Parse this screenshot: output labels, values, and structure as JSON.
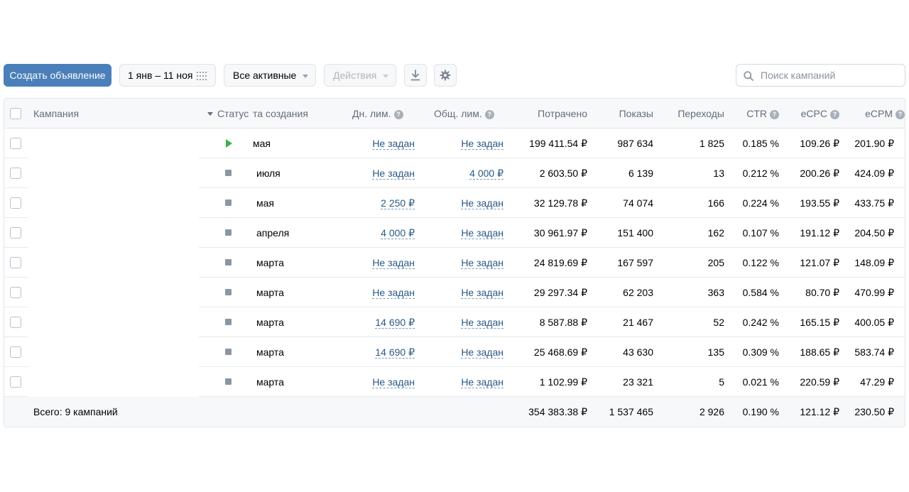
{
  "toolbar": {
    "create_label": "Создать объявление",
    "date_range": "1 янв – 11 ноя",
    "filter_label": "Все активные",
    "actions_label": "Действия",
    "download_icon": "download-icon",
    "settings_icon": "gear-icon"
  },
  "search": {
    "placeholder": "Поиск кампаний",
    "value": ""
  },
  "table": {
    "headers": {
      "campaign": "Кампания",
      "status": "Статус",
      "created": "та создания",
      "day_limit": "Дн. лим.",
      "total_limit": "Общ. лим.",
      "spent": "Потрачено",
      "impressions": "Показы",
      "clicks": "Переходы",
      "ctr": "CTR",
      "ecpc": "eCPC",
      "ecpm": "eCPM"
    },
    "help_mark": "?",
    "rows": [
      {
        "status": "running",
        "created": "мая",
        "day_limit": "Не задан",
        "total_limit": "Не задан",
        "spent": "199 411.54 ₽",
        "impressions": "987 634",
        "clicks": "1 825",
        "ctr": "0.185 %",
        "ecpc": "109.26 ₽",
        "ecpm": "201.90 ₽"
      },
      {
        "status": "stopped",
        "created": "июля",
        "day_limit": "Не задан",
        "total_limit": "4 000 ₽",
        "spent": "2 603.50 ₽",
        "impressions": "6 139",
        "clicks": "13",
        "ctr": "0.212 %",
        "ecpc": "200.26 ₽",
        "ecpm": "424.09 ₽"
      },
      {
        "status": "stopped",
        "created": "мая",
        "day_limit": "2 250 ₽",
        "total_limit": "Не задан",
        "spent": "32 129.78 ₽",
        "impressions": "74 074",
        "clicks": "166",
        "ctr": "0.224 %",
        "ecpc": "193.55 ₽",
        "ecpm": "433.75 ₽"
      },
      {
        "status": "stopped",
        "created": "апреля",
        "day_limit": "4 000 ₽",
        "total_limit": "Не задан",
        "spent": "30 961.97 ₽",
        "impressions": "151 400",
        "clicks": "162",
        "ctr": "0.107 %",
        "ecpc": "191.12 ₽",
        "ecpm": "204.50 ₽"
      },
      {
        "status": "stopped",
        "created": "марта",
        "day_limit": "Не задан",
        "total_limit": "Не задан",
        "spent": "24 819.69 ₽",
        "impressions": "167 597",
        "clicks": "205",
        "ctr": "0.122 %",
        "ecpc": "121.07 ₽",
        "ecpm": "148.09 ₽"
      },
      {
        "status": "stopped",
        "created": "марта",
        "day_limit": "Не задан",
        "total_limit": "Не задан",
        "spent": "29 297.34 ₽",
        "impressions": "62 203",
        "clicks": "363",
        "ctr": "0.584 %",
        "ecpc": "80.70 ₽",
        "ecpm": "470.99 ₽"
      },
      {
        "status": "stopped",
        "created": "марта",
        "day_limit": "14 690 ₽",
        "total_limit": "Не задан",
        "spent": "8 587.88 ₽",
        "impressions": "21 467",
        "clicks": "52",
        "ctr": "0.242 %",
        "ecpc": "165.15 ₽",
        "ecpm": "400.05 ₽"
      },
      {
        "status": "stopped",
        "created": "марта",
        "day_limit": "14 690 ₽",
        "total_limit": "Не задан",
        "spent": "25 468.69 ₽",
        "impressions": "43 630",
        "clicks": "135",
        "ctr": "0.309 %",
        "ecpc": "188.65 ₽",
        "ecpm": "583.74 ₽"
      },
      {
        "status": "stopped",
        "created": "марта",
        "day_limit": "Не задан",
        "total_limit": "Не задан",
        "spent": "1 102.99 ₽",
        "impressions": "23 321",
        "clicks": "5",
        "ctr": "0.021 %",
        "ecpc": "220.59 ₽",
        "ecpm": "47.29 ₽"
      }
    ],
    "total": {
      "label": "Всего: 9 кампаний",
      "spent": "354 383.38 ₽",
      "impressions": "1 537 465",
      "clicks": "2 926",
      "ctr": "0.190 %",
      "ecpc": "121.12 ₽",
      "ecpm": "230.50 ₽"
    }
  },
  "colors": {
    "primary": "#4a7fb9",
    "link": "#2a5885",
    "running": "#3cb04b",
    "stopped": "#8c96a3"
  }
}
